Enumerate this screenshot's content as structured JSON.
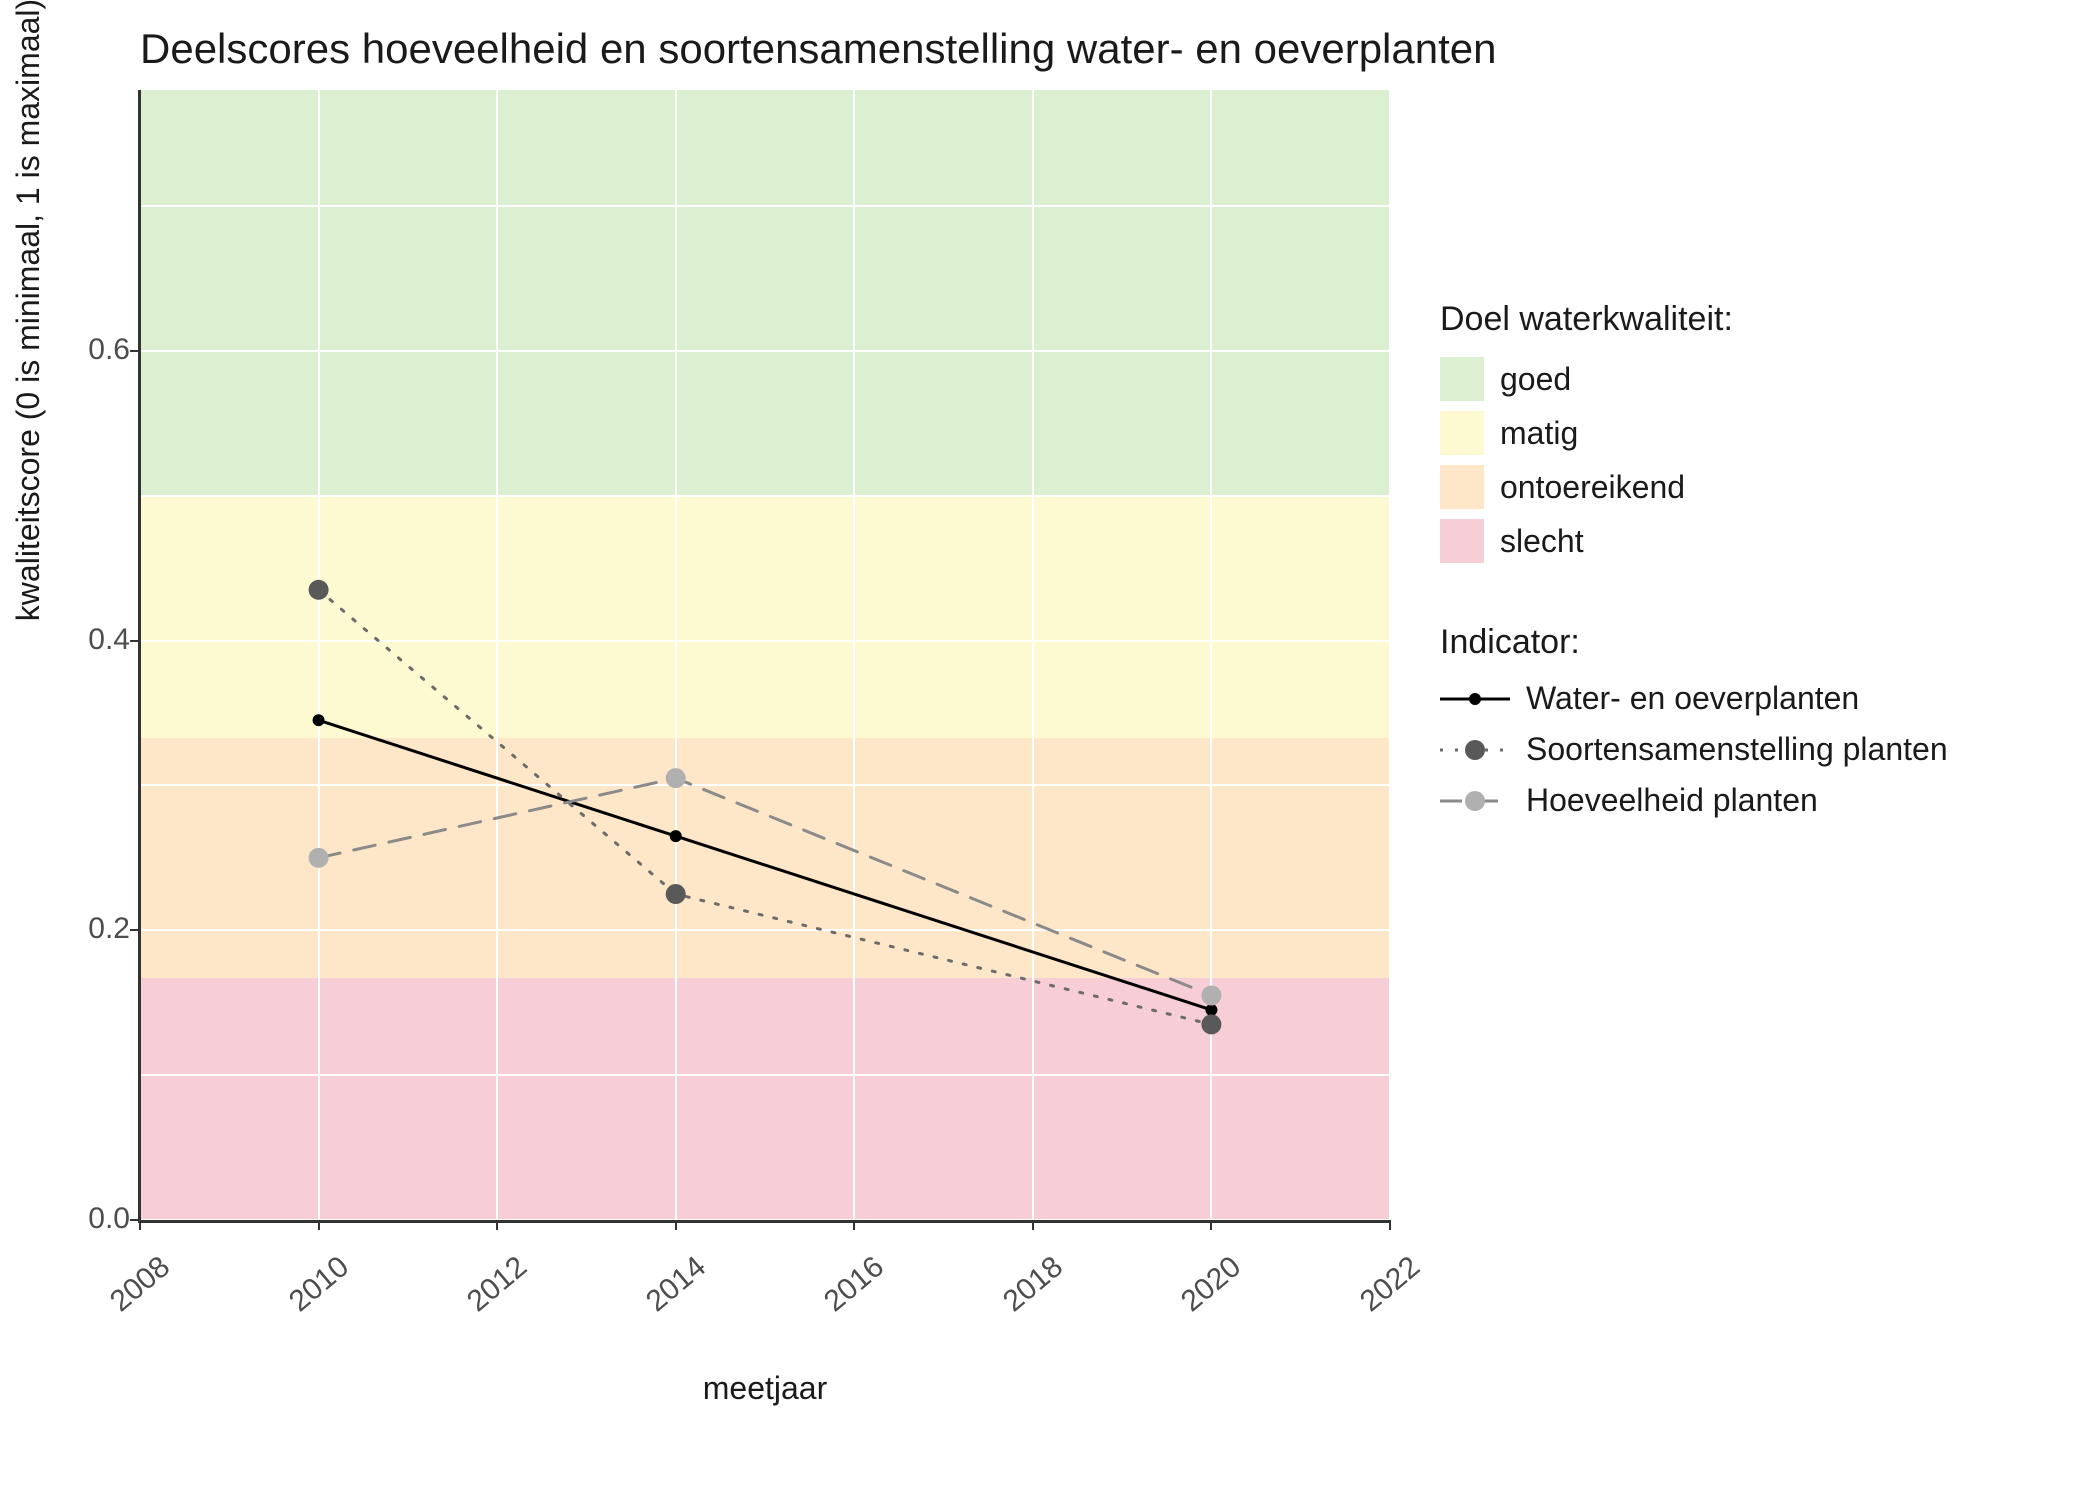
{
  "chart_data": {
    "type": "line",
    "title": "Deelscores hoeveelheid en soortensamenstelling water- en oeverplanten",
    "xlabel": "meetjaar",
    "ylabel": "kwaliteitscore (0 is minimaal, 1 is maximaal)",
    "xlim": [
      2008,
      2022
    ],
    "ylim": [
      0.0,
      0.78
    ],
    "x_ticks": [
      2008,
      2010,
      2012,
      2014,
      2016,
      2018,
      2020,
      2022
    ],
    "y_ticks": [
      0.0,
      0.2,
      0.4,
      0.6
    ],
    "x": [
      2010,
      2014,
      2020
    ],
    "series": [
      {
        "name": "Water- en oeverplanten",
        "values": [
          0.345,
          0.265,
          0.145
        ],
        "color": "#000000",
        "dash": "solid",
        "pointColor": "#000000",
        "pointR": 6
      },
      {
        "name": "Soortensamenstelling planten",
        "values": [
          0.435,
          0.225,
          0.135
        ],
        "color": "#6b6b6b",
        "dash": "dotted",
        "pointColor": "#595959",
        "pointR": 10
      },
      {
        "name": "Hoeveelheid planten",
        "values": [
          0.25,
          0.305,
          0.155
        ],
        "color": "#8a8a8a",
        "dash": "dashed",
        "pointColor": "#b0b0b0",
        "pointR": 10
      }
    ],
    "bands": [
      {
        "name": "goed",
        "from": 0.5,
        "to": 0.78,
        "color": "#dbf0d1"
      },
      {
        "name": "matig",
        "from": 0.333,
        "to": 0.5,
        "color": "#fdfad2"
      },
      {
        "name": "ontoereikend",
        "from": 0.167,
        "to": 0.333,
        "color": "#fde7c8"
      },
      {
        "name": "slecht",
        "from": 0.0,
        "to": 0.167,
        "color": "#f7cdd6"
      }
    ],
    "legend_band_title": "Doel waterkwaliteit:",
    "legend_series_title": "Indicator:"
  }
}
